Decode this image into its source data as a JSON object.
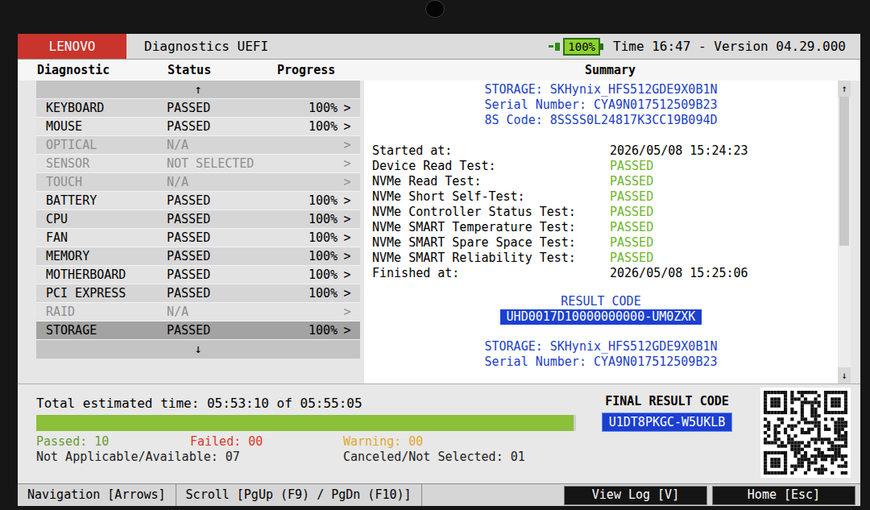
{
  "header": {
    "brand": "LENOVO",
    "title": "Diagnostics UEFI",
    "battery": "100%",
    "battery_level": 1,
    "time": "Time 16:47 - Version 04.29.000"
  },
  "columns": {
    "diagnostic": "Diagnostic",
    "status": "Status",
    "progress": "Progress",
    "summary": "Summary"
  },
  "list": {
    "up": "↑",
    "down": "↓",
    "items": [
      {
        "name": "KEYBOARD",
        "status": "PASSED",
        "progress": "100%",
        "arrow": ">",
        "disabled": false,
        "selected": false
      },
      {
        "name": "MOUSE",
        "status": "PASSED",
        "progress": "100%",
        "arrow": ">",
        "disabled": false,
        "selected": false
      },
      {
        "name": "OPTICAL",
        "status": "N/A",
        "progress": "",
        "arrow": ">",
        "disabled": true,
        "selected": false
      },
      {
        "name": "SENSOR",
        "status": "NOT SELECTED",
        "progress": "",
        "arrow": ">",
        "disabled": true,
        "selected": false
      },
      {
        "name": "TOUCH",
        "status": "N/A",
        "progress": "",
        "arrow": ">",
        "disabled": true,
        "selected": false
      },
      {
        "name": "BATTERY",
        "status": "PASSED",
        "progress": "100%",
        "arrow": ">",
        "disabled": false,
        "selected": false
      },
      {
        "name": "CPU",
        "status": "PASSED",
        "progress": "100%",
        "arrow": ">",
        "disabled": false,
        "selected": false
      },
      {
        "name": "FAN",
        "status": "PASSED",
        "progress": "100%",
        "arrow": ">",
        "disabled": false,
        "selected": false
      },
      {
        "name": "MEMORY",
        "status": "PASSED",
        "progress": "100%",
        "arrow": ">",
        "disabled": false,
        "selected": false
      },
      {
        "name": "MOTHERBOARD",
        "status": "PASSED",
        "progress": "100%",
        "arrow": ">",
        "disabled": false,
        "selected": false
      },
      {
        "name": "PCI EXPRESS",
        "status": "PASSED",
        "progress": "100%",
        "arrow": ">",
        "disabled": false,
        "selected": false
      },
      {
        "name": "RAID",
        "status": "N/A",
        "progress": "",
        "arrow": ">",
        "disabled": true,
        "selected": false
      },
      {
        "name": "STORAGE",
        "status": "PASSED",
        "progress": "100%",
        "arrow": ">",
        "disabled": false,
        "selected": true
      }
    ]
  },
  "summary": {
    "header_lines": [
      "STORAGE: SKHynix_HFS512GDE9X0B1N",
      "Serial Number: CYA9N017512509B23",
      "8S Code: 8SSSS0L24817K3CC19B094D"
    ],
    "rows": [
      {
        "label": "Started at:",
        "value": "2026/05/08 15:24:23",
        "kind": "time"
      },
      {
        "label": "Device Read Test:",
        "value": "PASSED",
        "kind": "test"
      },
      {
        "label": "NVMe Read Test:",
        "value": "PASSED",
        "kind": "test"
      },
      {
        "label": "NVMe Short Self-Test:",
        "value": "PASSED",
        "kind": "test"
      },
      {
        "label": "NVMe Controller Status Test:",
        "value": "PASSED",
        "kind": "test"
      },
      {
        "label": "NVMe SMART Temperature Test:",
        "value": "PASSED",
        "kind": "test"
      },
      {
        "label": "NVMe SMART Spare Space Test:",
        "value": "PASSED",
        "kind": "test"
      },
      {
        "label": "NVMe SMART Reliability Test:",
        "value": "PASSED",
        "kind": "test"
      },
      {
        "label": "Finished at:",
        "value": "2026/05/08 15:25:06",
        "kind": "time"
      }
    ],
    "result_label": "RESULT CODE",
    "result_code": "UHD0017D10000000000-UM0ZXK",
    "footer_lines": [
      "STORAGE: SKHynix_HFS512GDE9X0B1N",
      "Serial Number: CYA9N017512509B23"
    ],
    "scrollbar": {
      "up": "↑",
      "down": "↓",
      "thumb_start": 0.0,
      "thumb_size": 0.55
    }
  },
  "total": {
    "text": "Total estimated time: 05:53:10 of 05:55:05",
    "level": 0.995
  },
  "stats": {
    "lines": [
      [
        {
          "text": "Passed: 10",
          "color": "#6b9b37"
        },
        {
          "text": "Failed: 00",
          "color": "#d8392a"
        },
        {
          "text": "Warning: 00",
          "color": "#e0a830"
        }
      ],
      [
        {
          "text": "Not Applicable/Available: 07",
          "color": "#222222"
        },
        {
          "text": "Canceled/Not Selected: 01",
          "color": "#222222"
        }
      ]
    ]
  },
  "final": {
    "label": "FINAL RESULT CODE",
    "code": "U1DT8PKGC-W5UKLB"
  },
  "footer": [
    {
      "text": "Navigation [Arrows]",
      "kind": "hint"
    },
    {
      "text": "Scroll [PgUp (F9) / PgDn (F10)]",
      "kind": "hint"
    },
    {
      "text": "View Log [V]",
      "kind": "button"
    },
    {
      "text": "Home [Esc]",
      "kind": "button"
    }
  ]
}
